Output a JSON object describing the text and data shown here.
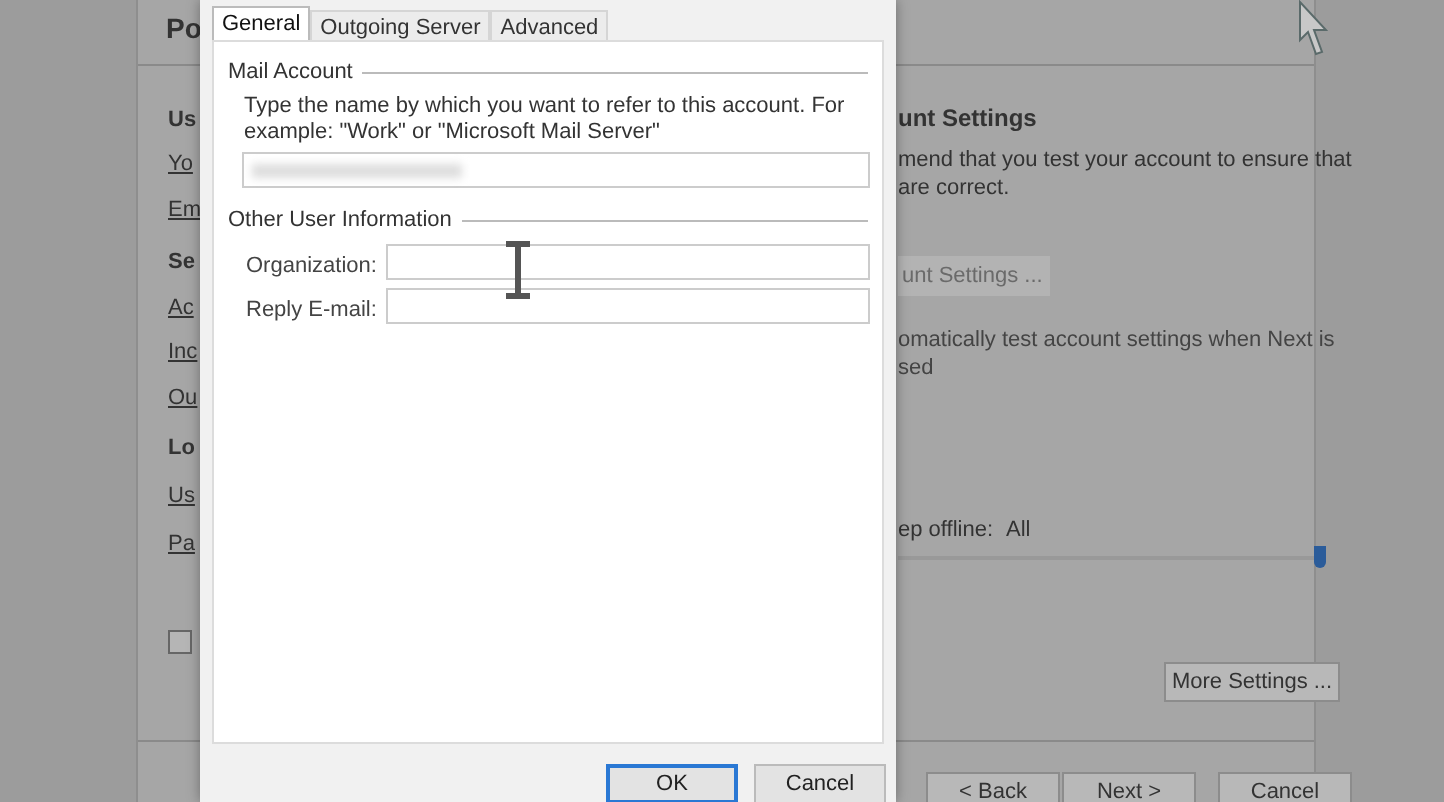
{
  "background_window": {
    "title": "Po",
    "left_labels": [
      {
        "text": "Us",
        "bold": true
      },
      {
        "text": "Yo",
        "bold": false
      },
      {
        "text": "Em",
        "bold": false
      },
      {
        "text": "Se",
        "bold": true
      },
      {
        "text": "Ac",
        "bold": false
      },
      {
        "text": "Inc",
        "bold": false
      },
      {
        "text": "Ou",
        "bold": false
      },
      {
        "text": "Lo",
        "bold": true
      },
      {
        "text": "Us",
        "bold": false
      },
      {
        "text": "Pa",
        "bold": false
      }
    ],
    "checkbox": {
      "checked": false
    },
    "heading": "unt Settings",
    "description": "mend that you test your account to ensure that\n are correct.",
    "test_button": {
      "label": "unt Settings ...",
      "disabled": true
    },
    "auto_test": "omatically test account settings when Next is\nsed",
    "offline_label": "ep offline:",
    "offline_value": "All",
    "offline_slider": {
      "level": 1
    },
    "more_settings_button": "More Settings ...",
    "buttons": [
      "< Back",
      "Next >",
      "Cancel"
    ]
  },
  "dialog": {
    "tabs": [
      {
        "label": "General",
        "selected": true
      },
      {
        "label": "Outgoing Server",
        "selected": false
      },
      {
        "label": "Advanced",
        "selected": false
      }
    ],
    "mail_account": {
      "title": "Mail Account",
      "description": "Type the name by which you want to refer to this account. For example: \"Work\" or \"Microsoft Mail Server\""
    },
    "other_info": {
      "title": "Other User Information",
      "fields": [
        {
          "label": "Organization:"
        },
        {
          "label": "Reply E-mail:"
        }
      ]
    },
    "buttons": [
      {
        "label": "OK",
        "default": true
      },
      {
        "label": "Cancel",
        "default": false
      }
    ]
  }
}
